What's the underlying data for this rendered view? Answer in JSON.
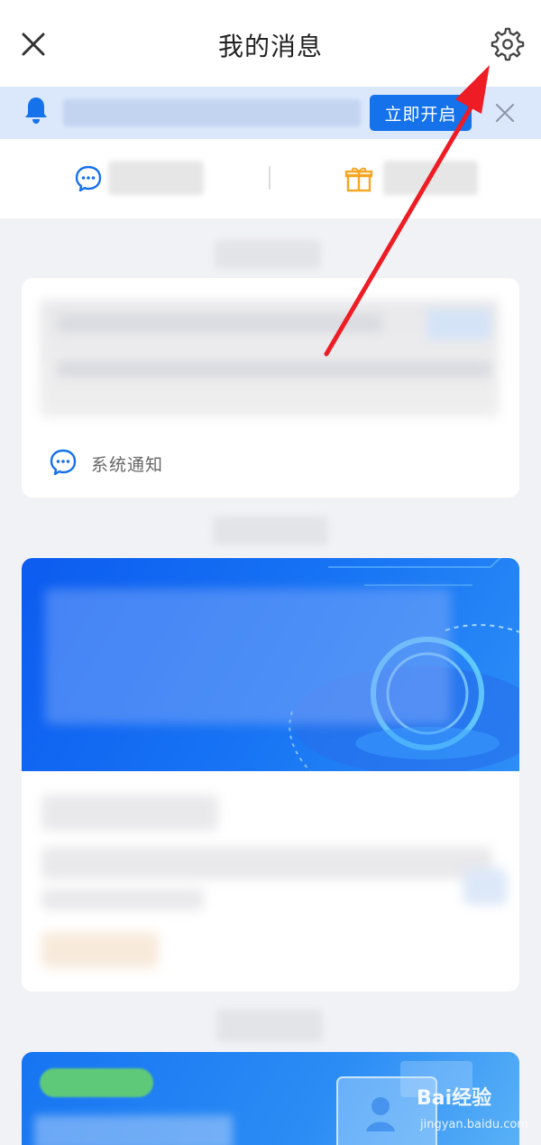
{
  "header": {
    "title": "我的消息",
    "close_icon": "close-icon",
    "settings_icon": "gear-icon"
  },
  "notice": {
    "button_label": "立即开启",
    "bell_icon": "bell-icon",
    "close_icon": "close-icon"
  },
  "tabs": {
    "left_icon": "chat-bubble-icon",
    "right_icon": "gift-icon"
  },
  "cards": {
    "system_notice_label": "系统通知"
  },
  "watermark": {
    "brand": "Bai经验",
    "url": "jingyan.baidu.com"
  },
  "colors": {
    "accent_blue": "#1672ea",
    "annotation_red": "#ee1c24",
    "gift_orange": "#f5a623"
  }
}
